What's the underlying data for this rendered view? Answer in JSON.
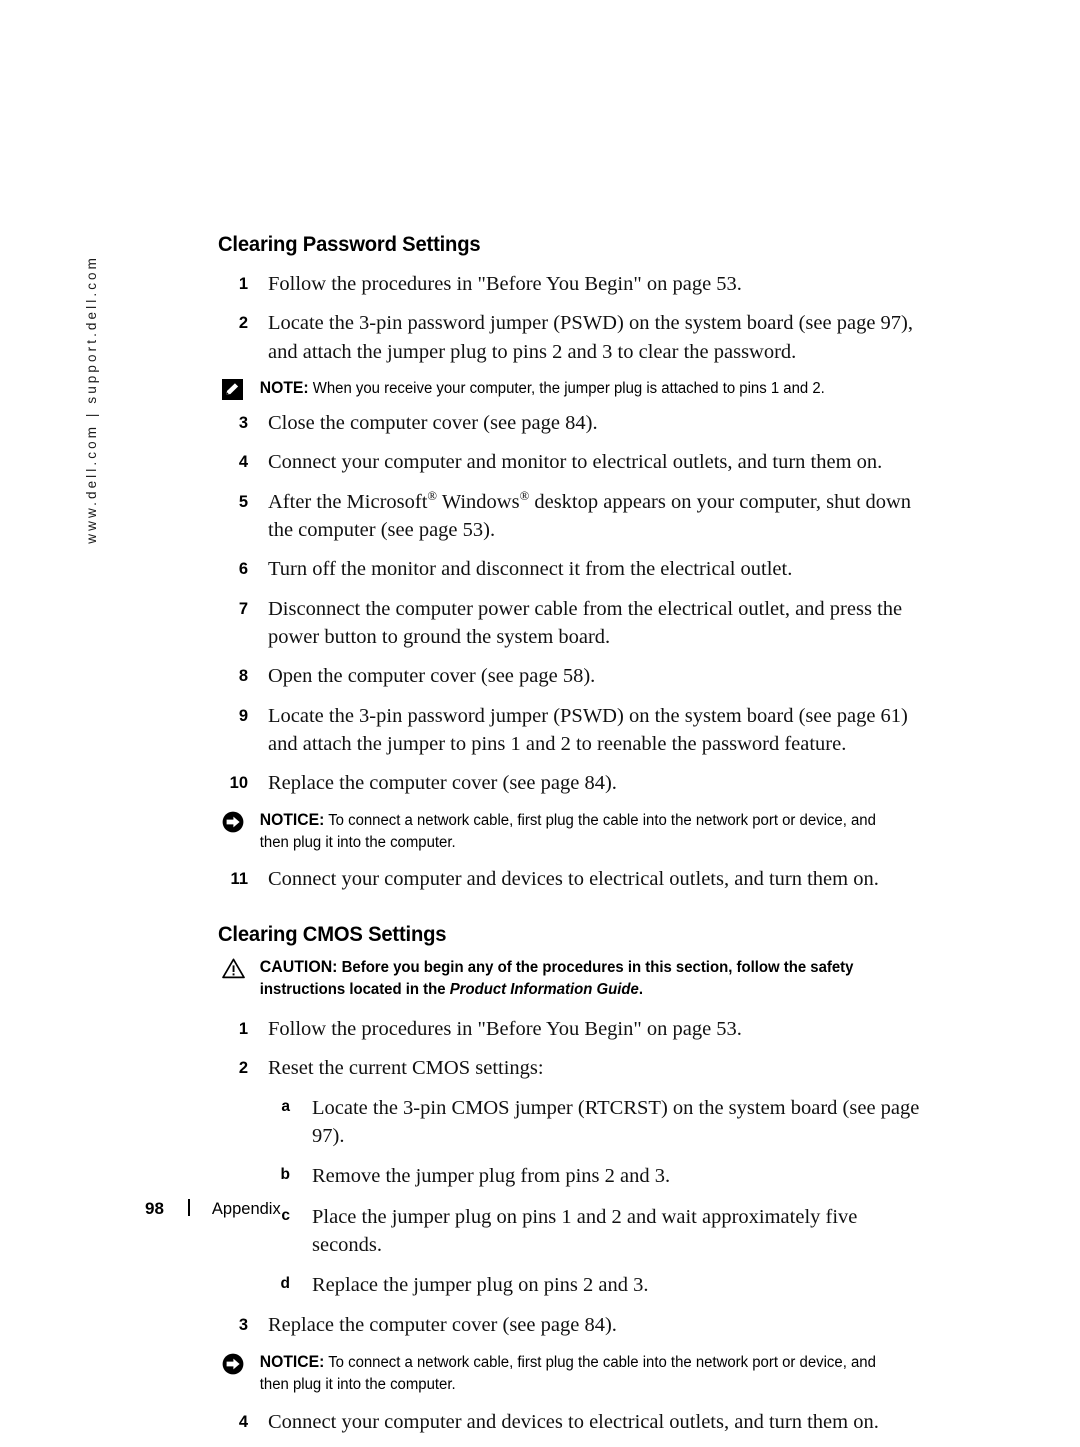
{
  "sidebar": {
    "url_text": "www.dell.com | support.dell.com"
  },
  "footer": {
    "page_number": "98",
    "label": "Appendix"
  },
  "sections": [
    {
      "heading": "Clearing Password Settings",
      "blocks": [
        {
          "kind": "step",
          "marker": "1",
          "text": "Follow the procedures in \"Before You Begin\" on page 53."
        },
        {
          "kind": "step",
          "marker": "2",
          "text": "Locate the 3-pin password jumper (PSWD) on the system board (see page 97), and attach the jumper plug to pins 2 and 3 to clear the password."
        },
        {
          "kind": "note",
          "label": "NOTE:",
          "text": "When you receive your computer, the jumper plug is attached to pins 1 and 2."
        },
        {
          "kind": "step",
          "marker": "3",
          "text": "Close the computer cover (see page 84)."
        },
        {
          "kind": "step",
          "marker": "4",
          "text": "Connect your computer and monitor to electrical outlets, and turn them on."
        },
        {
          "kind": "step-reg",
          "marker": "5",
          "pre": "After the Microsoft",
          "mid": " Windows",
          "post": " desktop appears on your computer, shut down the computer (see page 53)."
        },
        {
          "kind": "step",
          "marker": "6",
          "text": "Turn off the monitor and disconnect it from the electrical outlet."
        },
        {
          "kind": "step",
          "marker": "7",
          "text": "Disconnect the computer power cable from the electrical outlet, and press the power button to ground the system board."
        },
        {
          "kind": "step",
          "marker": "8",
          "text": "Open the computer cover (see page 58)."
        },
        {
          "kind": "step",
          "marker": "9",
          "text": "Locate the 3-pin password jumper (PSWD) on the system board (see page 61) and attach the jumper to pins 1 and 2 to reenable the password feature."
        },
        {
          "kind": "step",
          "marker": "10",
          "text": "Replace the computer cover (see page 84)."
        },
        {
          "kind": "notice",
          "label": "NOTICE:",
          "text": "To connect a network cable, first plug the cable into the network port or device, and then plug it into the computer."
        },
        {
          "kind": "step",
          "marker": "11",
          "text": "Connect your computer and devices to electrical outlets, and turn them on."
        }
      ]
    },
    {
      "heading": "Clearing CMOS Settings",
      "blocks": [
        {
          "kind": "caution",
          "label": "CAUTION:",
          "text": "Before you begin any of the procedures in this section, follow the safety instructions located in the ",
          "italic": "Product Information Guide",
          "tail": "."
        },
        {
          "kind": "step",
          "marker": "1",
          "text": "Follow the procedures in \"Before You Begin\" on page 53."
        },
        {
          "kind": "step",
          "marker": "2",
          "text": "Reset the current CMOS settings:"
        },
        {
          "kind": "substep",
          "marker": "a",
          "text": "Locate the 3-pin CMOS jumper (RTCRST) on the system board (see page 97)."
        },
        {
          "kind": "substep",
          "marker": "b",
          "text": "Remove the jumper plug from pins 2 and 3."
        },
        {
          "kind": "substep",
          "marker": "c",
          "text": "Place the jumper plug on pins 1 and 2 and wait approximately five seconds."
        },
        {
          "kind": "substep",
          "marker": "d",
          "text": "Replace the jumper plug on pins 2 and 3."
        },
        {
          "kind": "step",
          "marker": "3",
          "text": "Replace the computer cover (see page 84)."
        },
        {
          "kind": "notice",
          "label": "NOTICE:",
          "text": "To connect a network cable, first plug the cable into the network port or device, and then plug it into the computer."
        },
        {
          "kind": "step",
          "marker": "4",
          "text": "Connect your computer and devices to electrical outlets, and turn them on."
        }
      ]
    }
  ],
  "icons": {
    "note": "note-pencil-icon",
    "notice": "notice-arrow-icon",
    "caution": "caution-triangle-icon"
  },
  "colors": {
    "ink": "#000000",
    "body_text": "#111111",
    "background": "#ffffff"
  }
}
